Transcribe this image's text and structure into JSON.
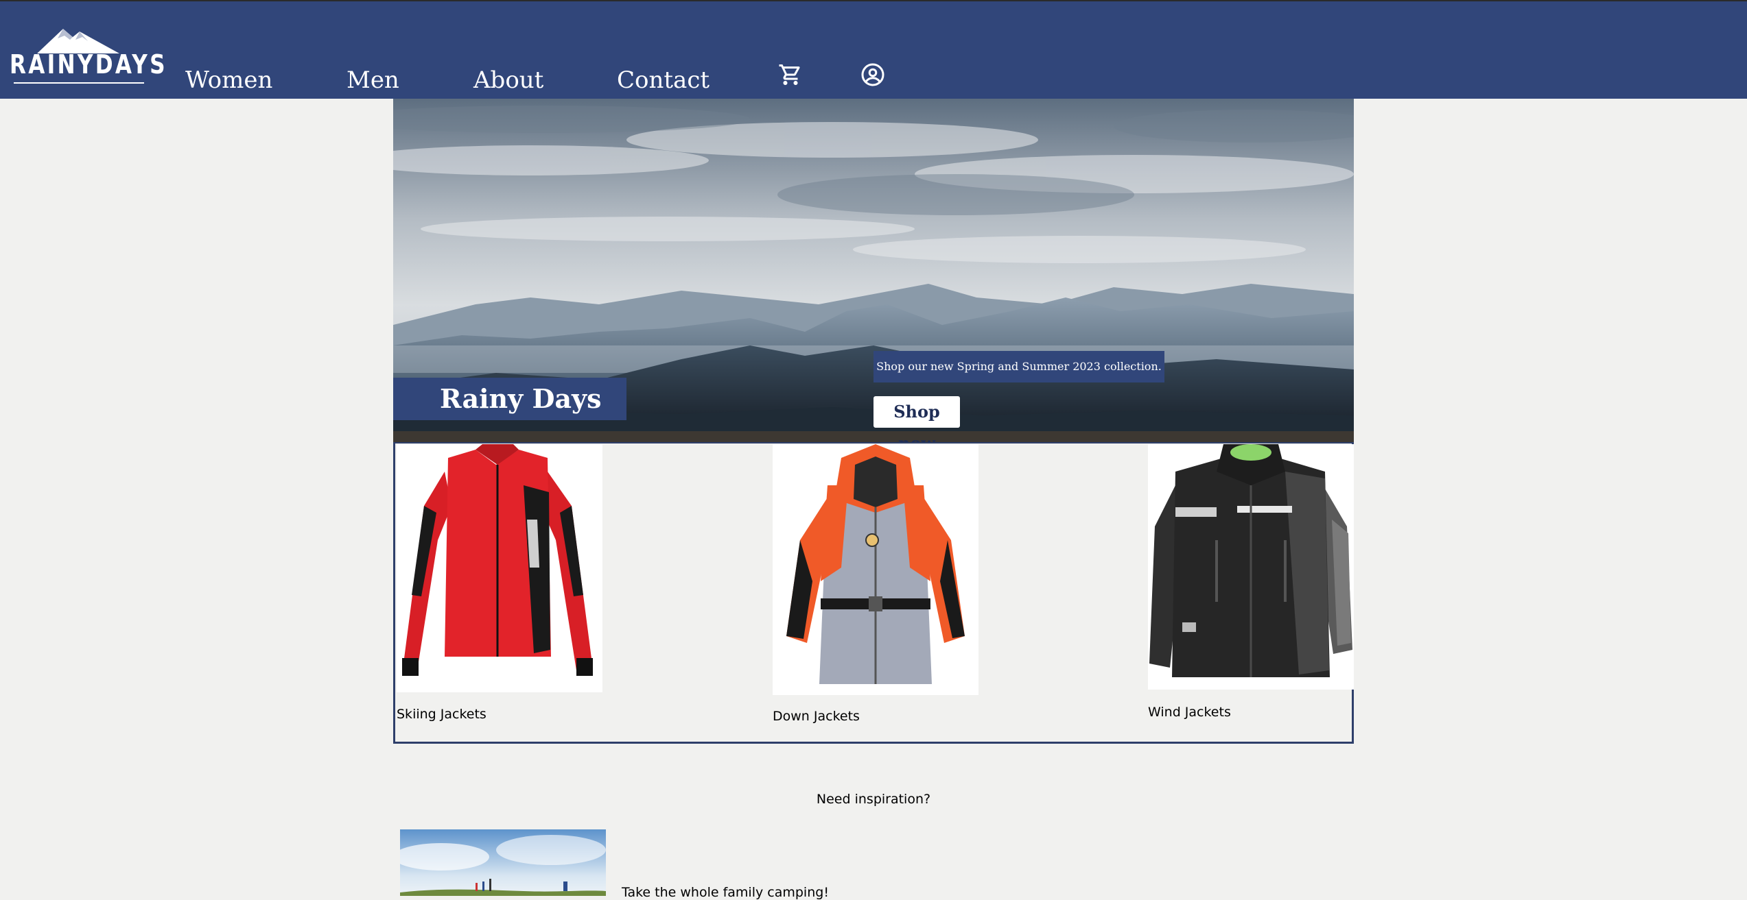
{
  "header": {
    "logo_text": "RAINYDAYS",
    "nav": [
      {
        "label": "Women"
      },
      {
        "label": "Men"
      },
      {
        "label": "About"
      },
      {
        "label": "Contact"
      }
    ],
    "icons": [
      "shopping-cart-icon",
      "account-circle-icon"
    ]
  },
  "hero": {
    "title": "Rainy Days",
    "promo": "Shop our new Spring and Summer 2023 collection.",
    "cta": "Shop now"
  },
  "products": [
    {
      "label": "Skiing Jackets"
    },
    {
      "label": "Down Jackets"
    },
    {
      "label": "Wind Jackets"
    }
  ],
  "inspiration": {
    "heading": "Need inspiration?",
    "text": "Take the whole family camping!"
  },
  "colors": {
    "brand": "#31467a",
    "page_bg": "#f1f1ef",
    "white": "#ffffff"
  }
}
